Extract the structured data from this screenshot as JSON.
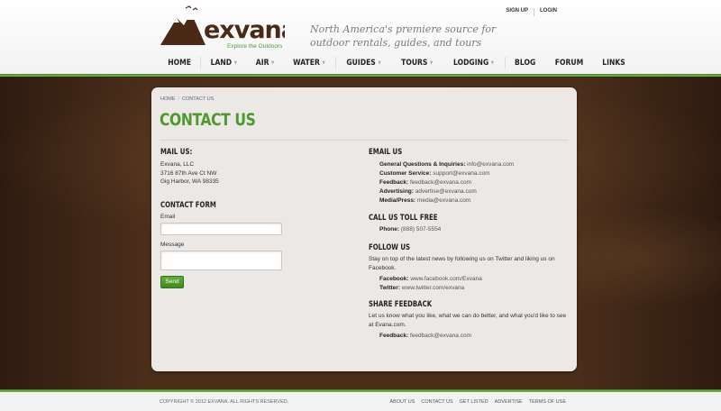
{
  "header": {
    "logo_text": "exvana",
    "logo_subtext": "Explore the Outdoors",
    "tagline": "North America's premiere source for outdoor rentals, guides, and tours",
    "top_links": [
      "SIGN UP",
      "LOGIN"
    ],
    "nav": [
      {
        "label": "HOME",
        "dropdown": false
      },
      {
        "label": "LAND",
        "dropdown": true
      },
      {
        "label": "AIR",
        "dropdown": true
      },
      {
        "label": "WATER",
        "dropdown": true
      },
      {
        "label": "GUIDES",
        "dropdown": true
      },
      {
        "label": "TOURS",
        "dropdown": true
      },
      {
        "label": "LODGING",
        "dropdown": true
      },
      {
        "label": "BLOG",
        "dropdown": false
      },
      {
        "label": "FORUM",
        "dropdown": false
      },
      {
        "label": "LINKS",
        "dropdown": false
      }
    ]
  },
  "breadcrumb": [
    "HOME",
    "CONTACT US"
  ],
  "page_title": "CONTACT US",
  "mail": {
    "heading": "MAIL US:",
    "lines": [
      "Exvana, LLC",
      "3716 87th Ave Ct NW",
      "Gig Harbor, WA 98335"
    ]
  },
  "form": {
    "heading": "CONTACT FORM",
    "email_label": "Email",
    "message_label": "Message",
    "send_label": "Send"
  },
  "email": {
    "heading": "EMAIL US",
    "rows": [
      {
        "label": "General Questions & Inquiries:",
        "value": "info@exvana.com"
      },
      {
        "label": "Customer Service:",
        "value": "support@exvana.com"
      },
      {
        "label": "Feedback:",
        "value": "feedback@exvana.com"
      },
      {
        "label": "Advertising:",
        "value": "advertise@exvana.com"
      },
      {
        "label": "Media/Press:",
        "value": "media@exvana.com"
      }
    ]
  },
  "phone": {
    "heading": "CALL US TOLL FREE",
    "label": "Phone:",
    "value": "(888) 507-5554"
  },
  "follow": {
    "heading": "FOLLOW US",
    "text": "Stay on top of the latest news by following us on Twitter and liking us on Facebook.",
    "rows": [
      {
        "label": "Facebook:",
        "value": "www.facebook.com/Exvana"
      },
      {
        "label": "Twitter:",
        "value": "www.twitter.com/exvana"
      }
    ]
  },
  "share": {
    "heading": "SHARE FEEDBACK",
    "text": "Let us know what you like, what we can do better, and what you'd like to see at Evana.com.",
    "label": "Feedback:",
    "value": "feedback@exvana.com"
  },
  "footer": {
    "copyright": "COPYRIGHT © 2012 EXVANA. ALL RIGHTS RESERVED.",
    "links": [
      "ABOUT US",
      "CONTACT US",
      "GET LISTED",
      "ADVERTISE",
      "TERMS OF USE"
    ]
  },
  "colors": {
    "accent_green": "#4e9a2c",
    "brand_brown": "#4a2a17",
    "background": "#3a2416"
  }
}
